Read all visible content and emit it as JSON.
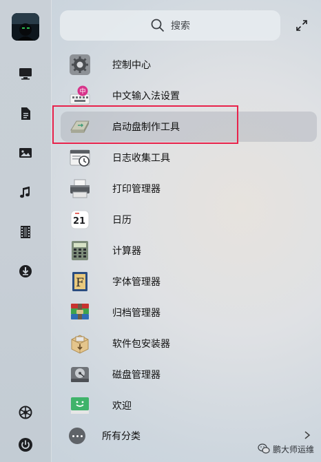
{
  "search": {
    "placeholder": "搜索"
  },
  "apps": [
    {
      "label": "控制中心",
      "icon": "gear-icon"
    },
    {
      "label": "中文输入法设置",
      "icon": "keyboard-ime-icon",
      "badge": "中"
    },
    {
      "label": "启动盘制作工具",
      "icon": "usb-drive-icon",
      "selected": true
    },
    {
      "label": "日志收集工具",
      "icon": "log-clock-icon"
    },
    {
      "label": "打印管理器",
      "icon": "printer-icon"
    },
    {
      "label": "日历",
      "icon": "calendar-icon",
      "day": "21"
    },
    {
      "label": "计算器",
      "icon": "calculator-icon"
    },
    {
      "label": "字体管理器",
      "icon": "font-book-icon",
      "glyph": "F"
    },
    {
      "label": "归档管理器",
      "icon": "archive-icon"
    },
    {
      "label": "软件包安装器",
      "icon": "package-icon"
    },
    {
      "label": "磁盘管理器",
      "icon": "disk-icon"
    },
    {
      "label": "欢迎",
      "icon": "welcome-icon"
    }
  ],
  "all_categories": {
    "label": "所有分类"
  },
  "dock": [
    {
      "name": "computer-icon"
    },
    {
      "name": "document-icon"
    },
    {
      "name": "picture-icon"
    },
    {
      "name": "music-icon"
    },
    {
      "name": "video-icon"
    },
    {
      "name": "download-icon"
    },
    {
      "name": "settings-icon"
    },
    {
      "name": "power-icon"
    }
  ],
  "watermark": {
    "text": "鹏大师运维"
  },
  "colors": {
    "highlight": "#e8214a",
    "selected_bg": "#aab0b8"
  }
}
